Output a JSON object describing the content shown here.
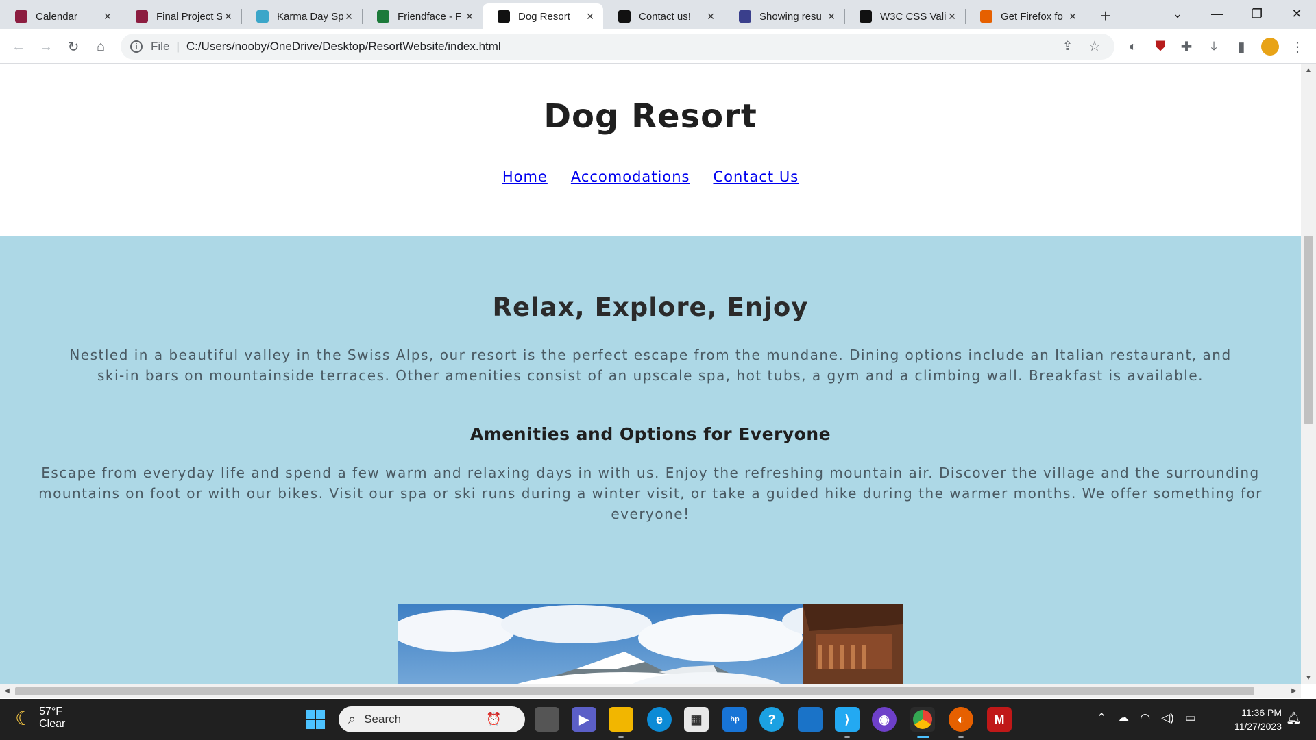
{
  "browser": {
    "tabs": [
      {
        "title": "Calendar",
        "favicon": "asu-logo",
        "color": "#8c1d40"
      },
      {
        "title": "Final Project S",
        "favicon": "asu-logo",
        "color": "#8c1d40"
      },
      {
        "title": "Karma Day Sp",
        "favicon": "lotus",
        "color": "#3ba6c9"
      },
      {
        "title": "Friendface - F",
        "favicon": "f-logo",
        "color": "#1c7a3a"
      },
      {
        "title": "Dog Resort",
        "favicon": "dog-logo",
        "color": "#111111"
      },
      {
        "title": "Contact us!",
        "favicon": "dog-logo",
        "color": "#111111"
      },
      {
        "title": "Showing resu",
        "favicon": "wolf-logo",
        "color": "#3a3f8c"
      },
      {
        "title": "W3C CSS Vali",
        "favicon": "w3c-logo",
        "color": "#111111"
      },
      {
        "title": "Get Firefox fo",
        "favicon": "firefox-logo",
        "color": "#e66000"
      }
    ],
    "active_tab": 4,
    "new_tab_label": "+",
    "address": {
      "scheme_label": "File",
      "url": "C:/Users/nooby/OneDrive/Desktop/ResortWebsite/index.html"
    }
  },
  "site": {
    "title": "Dog Resort",
    "nav": [
      {
        "label": "Home"
      },
      {
        "label": "Accomodations"
      },
      {
        "label": "Contact Us"
      }
    ],
    "main": {
      "heading": "Relax, Explore, Enjoy",
      "intro": "Nestled in a beautiful valley in the Swiss Alps, our resort is the perfect escape from the mundane. Dining options include an Italian restaurant, and ski-in bars on mountainside terraces. Other amenities consist of an upscale spa, hot tubs, a gym and a climbing wall. Breakfast is available.",
      "subheading": "Amenities and Options for Everyone",
      "options": "Escape from everyday life and spend a few warm and relaxing days in with us. Enjoy the refreshing mountain air. Discover the village and the surrounding mountains on foot or with our bikes. Visit our spa or ski runs during a winter visit, or take a guided hike during the warmer months. We offer something for everyone!"
    },
    "colors": {
      "section_bg": "#add8e6",
      "link": "#0000ee"
    }
  },
  "taskbar": {
    "weather": {
      "temp": "57°F",
      "condition": "Clear"
    },
    "search_placeholder": "Search",
    "clock": {
      "time": "11:36 PM",
      "date": "11/27/2023"
    }
  }
}
